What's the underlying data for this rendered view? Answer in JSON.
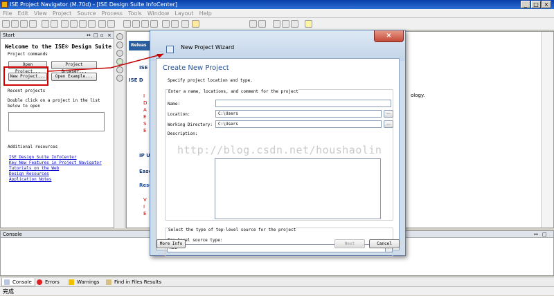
{
  "window": {
    "title": "ISE Project Navigator (M.70d) - [ISE Design Suite InfoCenter]"
  },
  "menu": [
    "File",
    "Edit",
    "View",
    "Project",
    "Source",
    "Process",
    "Tools",
    "Window",
    "Layout",
    "Help"
  ],
  "start_panel": {
    "header": "Start",
    "welcome": "Welcome to the ISE® Design Suite",
    "project_commands_label": "Project commands",
    "open_project": "Open Project...",
    "project_browser": "Project Browser...",
    "new_project": "New Project...",
    "open_example": "Open Example...",
    "recent_projects_label": "Recent projects",
    "recent_hint_line1": "Double click on a project in the list",
    "recent_hint_line2": "below to open",
    "additional_resources_label": "Additional resources",
    "links": [
      "ISE Design Suite InfoCenter",
      "Key New Features in Project Navigator",
      "Tutorials on the Web",
      "Design Resources",
      "Application Notes"
    ]
  },
  "content": {
    "tab": "Releas",
    "line1": "ISE",
    "line2": "ISE D",
    "bullets": [
      "I",
      "D",
      "A",
      "E",
      "S",
      "E"
    ],
    "ip_up": "IP U",
    "ease": "Ease",
    "reso": "Reso",
    "bullets2": [
      "V",
      "I",
      "E"
    ],
    "tail_text": "ology."
  },
  "dialog": {
    "title": "New Project Wizard",
    "heading": "Create New Project",
    "subtitle": "Specify project location and type.",
    "group1_label": "Enter a name, locations, and comment for the project",
    "name_label": "Name:",
    "name_value": "",
    "location_label": "Location:",
    "location_value": "C:\\Users",
    "working_dir_label": "Working Directory:",
    "working_dir_value": "C:\\Users",
    "description_label": "Description:",
    "dots": "...",
    "group2_label": "Select the type of top-level source for the project",
    "source_type_label": "Top-level source type:",
    "source_type_value": "HDL",
    "more_info": "More Info",
    "next": "Next",
    "cancel": "Cancel"
  },
  "console": {
    "header": "Console"
  },
  "bottom_tabs": [
    "Console",
    "Errors",
    "Warnings",
    "Find in Files Results"
  ],
  "status_bar": "完成",
  "watermark": "http://blog.csdn.net/houshaolin",
  "colors": {
    "title_bar": "#1c56c0",
    "highlight_box": "#d00000",
    "dialog_heading": "#1f4fa0",
    "link": "#0000cc"
  }
}
